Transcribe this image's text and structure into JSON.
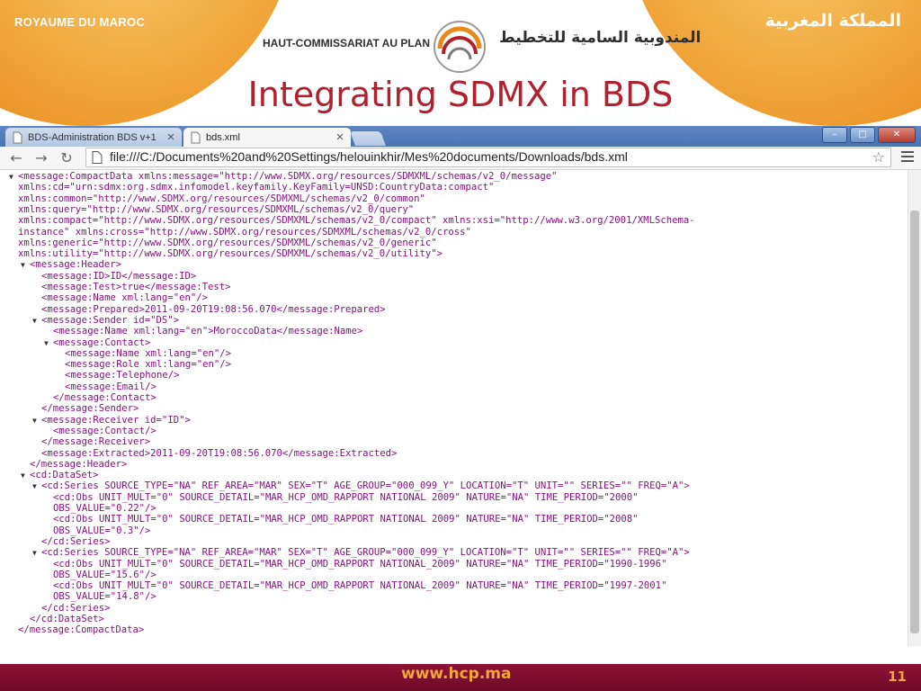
{
  "slide": {
    "kingdom_fr": "ROYAUME DU MAROC",
    "kingdom_ar": "المملكة المغربية",
    "hcp_fr": "HAUT-COMMISSARIAT AU PLAN",
    "hcp_ar": "المندوبية السامية للتخطيط",
    "title": "Integrating SDMX in BDS",
    "footer_url": "www.hcp.ma",
    "page_number": "11",
    "colors": {
      "orange": "#f0a53a",
      "title_red": "#b21f2d",
      "footer_maroon": "#7e0f2e"
    }
  },
  "browser": {
    "tabs": [
      {
        "label": "BDS-Administration BDS v+1",
        "active": false,
        "icon": "document-icon"
      },
      {
        "label": "bds.xml",
        "active": true,
        "icon": "document-icon"
      }
    ],
    "window_controls": {
      "minimize": "–",
      "maximize": "□",
      "close": "✕"
    },
    "nav": {
      "back": "←",
      "forward": "→",
      "reload": "↻"
    },
    "address": "file:///C:/Documents%20and%20Settings/helouinkhir/Mes%20documents/Downloads/bds.xml",
    "star": "☆"
  },
  "xml_lines": [
    {
      "indent": 0,
      "toggle": "▼",
      "text": "<message:CompactData xmlns:message=\"http://www.SDMX.org/resources/SDMXML/schemas/v2_0/message\""
    },
    {
      "indent": 0,
      "toggle": "",
      "text": "xmlns:cd=\"urn:sdmx:org.sdmx.infomodel.keyfamily.KeyFamily=UNSD:CountryData:compact\""
    },
    {
      "indent": 0,
      "toggle": "",
      "text": "xmlns:common=\"http://www.SDMX.org/resources/SDMXML/schemas/v2_0/common\""
    },
    {
      "indent": 0,
      "toggle": "",
      "text": "xmlns:query=\"http://www.SDMX.org/resources/SDMXML/schemas/v2_0/query\""
    },
    {
      "indent": 0,
      "toggle": "",
      "text": "xmlns:compact=\"http://www.SDMX.org/resources/SDMXML/schemas/v2_0/compact\" xmlns:xsi=\"http://www.w3.org/2001/XMLSchema-"
    },
    {
      "indent": 0,
      "toggle": "",
      "text": "instance\" xmlns:cross=\"http://www.SDMX.org/resources/SDMXML/schemas/v2_0/cross\""
    },
    {
      "indent": 0,
      "toggle": "",
      "text": "xmlns:generic=\"http://www.SDMX.org/resources/SDMXML/schemas/v2_0/generic\""
    },
    {
      "indent": 0,
      "toggle": "",
      "text": "xmlns:utility=\"http://www.SDMX.org/resources/SDMXML/schemas/v2_0/utility\">"
    },
    {
      "indent": 1,
      "toggle": "▼",
      "text": "<message:Header>"
    },
    {
      "indent": 2,
      "toggle": "",
      "text": "<message:ID>ID</message:ID>"
    },
    {
      "indent": 2,
      "toggle": "",
      "text": "<message:Test>true</message:Test>"
    },
    {
      "indent": 2,
      "toggle": "",
      "text": "<message:Name xml:lang=\"en\"/>"
    },
    {
      "indent": 2,
      "toggle": "",
      "text": "<message:Prepared>2011-09-20T19:08:56.070</message:Prepared>"
    },
    {
      "indent": 2,
      "toggle": "▼",
      "text": "<message:Sender id=\"DS\">"
    },
    {
      "indent": 3,
      "toggle": "",
      "text": "<message:Name xml:lang=\"en\">MoroccoData</message:Name>"
    },
    {
      "indent": 3,
      "toggle": "▼",
      "text": "<message:Contact>"
    },
    {
      "indent": 4,
      "toggle": "",
      "text": "<message:Name xml:lang=\"en\"/>"
    },
    {
      "indent": 4,
      "toggle": "",
      "text": "<message:Role xml:lang=\"en\"/>"
    },
    {
      "indent": 4,
      "toggle": "",
      "text": "<message:Telephone/>"
    },
    {
      "indent": 4,
      "toggle": "",
      "text": "<message:Email/>"
    },
    {
      "indent": 3,
      "toggle": "",
      "text": "</message:Contact>"
    },
    {
      "indent": 2,
      "toggle": "",
      "text": "</message:Sender>"
    },
    {
      "indent": 2,
      "toggle": "▼",
      "text": "<message:Receiver id=\"ID\">"
    },
    {
      "indent": 3,
      "toggle": "",
      "text": "<message:Contact/>"
    },
    {
      "indent": 2,
      "toggle": "",
      "text": "</message:Receiver>"
    },
    {
      "indent": 2,
      "toggle": "",
      "text": "<message:Extracted>2011-09-20T19:08:56.070</message:Extracted>"
    },
    {
      "indent": 1,
      "toggle": "",
      "text": "</message:Header>"
    },
    {
      "indent": 1,
      "toggle": "▼",
      "text": "<cd:DataSet>"
    },
    {
      "indent": 2,
      "toggle": "▼",
      "text": "<cd:Series SOURCE_TYPE=\"NA\" REF_AREA=\"MAR\" SEX=\"T\" AGE_GROUP=\"000_099_Y\" LOCATION=\"T\" UNIT=\"\" SERIES=\"\" FREQ=\"A\">"
    },
    {
      "indent": 3,
      "toggle": "",
      "text": "<cd:Obs UNIT_MULT=\"0\" SOURCE_DETAIL=\"MAR_HCP_OMD_RAPPORT NATIONAL 2009\" NATURE=\"NA\" TIME_PERIOD=\"2000\""
    },
    {
      "indent": 3,
      "toggle": "",
      "text": "OBS_VALUE=\"0.22\"/>"
    },
    {
      "indent": 3,
      "toggle": "",
      "text": "<cd:Obs UNIT_MULT=\"0\" SOURCE_DETAIL=\"MAR_HCP_OMD_RAPPORT NATIONAL 2009\" NATURE=\"NA\" TIME_PERIOD=\"2008\""
    },
    {
      "indent": 3,
      "toggle": "",
      "text": "OBS_VALUE=\"0.3\"/>"
    },
    {
      "indent": 2,
      "toggle": "",
      "text": "</cd:Series>"
    },
    {
      "indent": 2,
      "toggle": "▼",
      "text": "<cd:Series SOURCE_TYPE=\"NA\" REF_AREA=\"MAR\" SEX=\"T\" AGE_GROUP=\"000_099_Y\" LOCATION=\"T\" UNIT=\"\" SERIES=\"\" FREQ=\"A\">"
    },
    {
      "indent": 3,
      "toggle": "",
      "text": "<cd:Obs UNIT_MULT=\"0\" SOURCE_DETAIL=\"MAR_HCP_OMD_RAPPORT NATIONAL_2009\" NATURE=\"NA\" TIME_PERIOD=\"1990-1996\""
    },
    {
      "indent": 3,
      "toggle": "",
      "text": "OBS_VALUE=\"15.6\"/>"
    },
    {
      "indent": 3,
      "toggle": "",
      "text": "<cd:Obs UNIT_MULT=\"0\" SOURCE_DETAIL=\"MAR_HCP_OMD_RAPPORT NATIONAL_2009\" NATURE=\"NA\" TIME_PERIOD=\"1997-2001\""
    },
    {
      "indent": 3,
      "toggle": "",
      "text": "OBS_VALUE=\"14.8\"/>"
    },
    {
      "indent": 2,
      "toggle": "",
      "text": "</cd:Series>"
    },
    {
      "indent": 1,
      "toggle": "",
      "text": "</cd:DataSet>"
    },
    {
      "indent": 0,
      "toggle": "",
      "text": "</message:CompactData>"
    }
  ]
}
